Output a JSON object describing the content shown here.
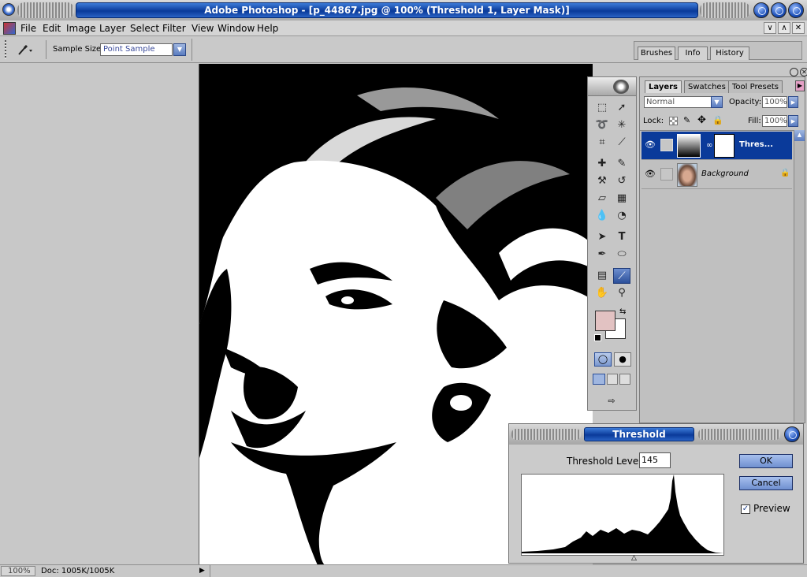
{
  "app": {
    "title": "Adobe Photoshop - [p_44867.jpg @ 100% (Threshold 1, Layer Mask)]"
  },
  "menu": [
    "File",
    "Edit",
    "Image",
    "Layer",
    "Select",
    "Filter",
    "View",
    "Window",
    "Help"
  ],
  "mdi_buttons": [
    "∨",
    "∧",
    "✕"
  ],
  "options": {
    "sample_size_label": "Sample Size:",
    "sample_size_value": "Point Sample"
  },
  "palette_well_tabs": [
    "Brushes",
    "Info",
    "History"
  ],
  "layers_palette": {
    "tabs": [
      "Layers",
      "Swatches",
      "Tool Presets"
    ],
    "blend_mode": "Normal",
    "opacity_label": "Opacity:",
    "opacity_value": "100%",
    "lock_label": "Lock:",
    "fill_label": "Fill:",
    "fill_value": "100%",
    "layers": [
      {
        "name": "Thres...",
        "selected": true
      },
      {
        "name": "Background",
        "selected": false
      }
    ]
  },
  "threshold_dialog": {
    "title": "Threshold",
    "level_label": "Threshold Level:",
    "level_value": "145",
    "ok_label": "OK",
    "cancel_label": "Cancel",
    "preview_label": "Preview",
    "preview_checked": true
  },
  "status": {
    "zoom": "100%",
    "doc": "Doc: 1005K/1005K"
  },
  "colors": {
    "accent": "#0a3a9a",
    "foreground_swatch": "#e2c2c2",
    "background_swatch": "#ffffff"
  }
}
